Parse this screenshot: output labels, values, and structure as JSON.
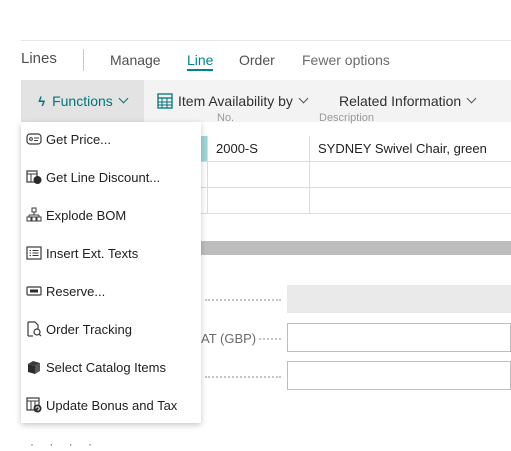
{
  "tabs": {
    "title": "Lines",
    "items": [
      "Manage",
      "Line",
      "Order",
      "Fewer options"
    ],
    "active": "Line"
  },
  "actions": {
    "functions": "Functions",
    "item_availability": "Item Availability by",
    "related_information": "Related Information"
  },
  "grid": {
    "columns": [
      "",
      "No.",
      "Description"
    ],
    "rows": [
      {
        "no": "2000-S",
        "description": "SYDNEY Swivel Chair, green",
        "selected": true
      },
      {
        "no": "",
        "description": ""
      },
      {
        "no": "",
        "description": ""
      }
    ]
  },
  "fields": {
    "vat_label_fragment": "AT (GBP)"
  },
  "menu": {
    "items": [
      {
        "label": "Get Price...",
        "icon": "price-tag-icon"
      },
      {
        "label": "Get Line Discount...",
        "icon": "line-discount-icon"
      },
      {
        "label": "Explode BOM",
        "icon": "bom-tree-icon"
      },
      {
        "label": "Insert Ext. Texts",
        "icon": "text-list-icon"
      },
      {
        "label": "Reserve...",
        "icon": "reserve-icon"
      },
      {
        "label": "Order Tracking",
        "icon": "order-tracking-icon"
      },
      {
        "label": "Select Catalog Items",
        "icon": "catalog-icon"
      },
      {
        "label": "Update Bonus and Tax",
        "icon": "bonus-tax-icon"
      }
    ]
  },
  "colors": {
    "accent": "#008489",
    "selection": "#9fd6d8"
  }
}
